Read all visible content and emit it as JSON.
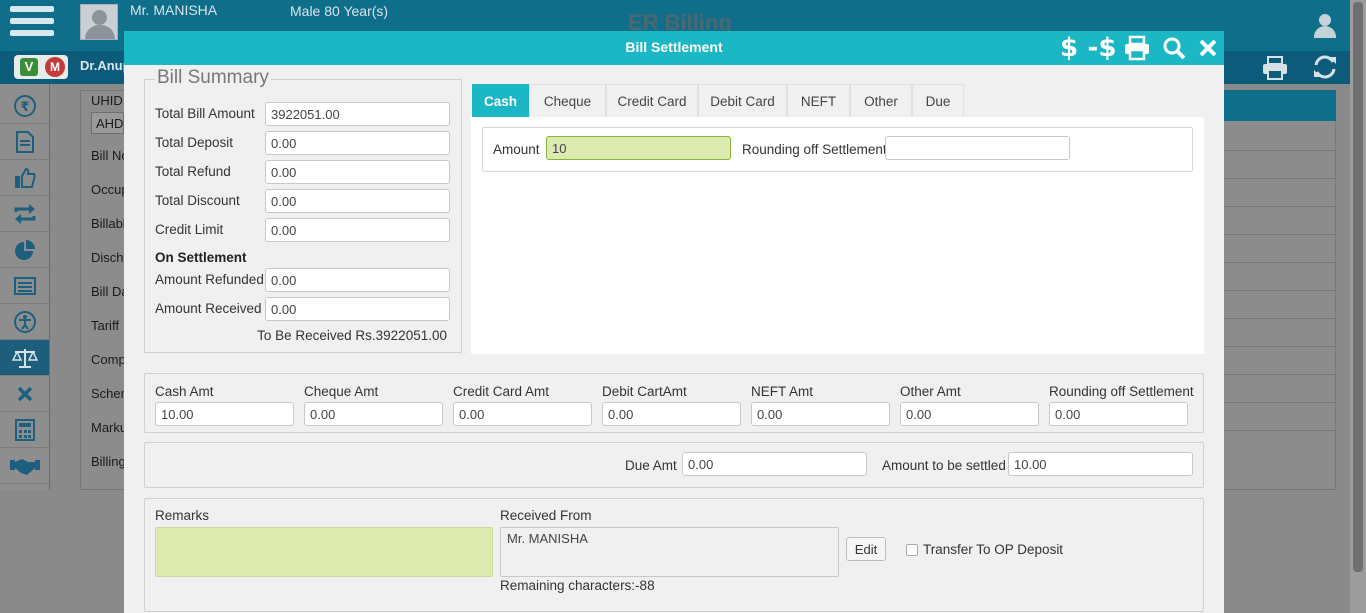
{
  "app": {
    "title": "ER Billing",
    "patient_name": "Mr. MANISHA",
    "patient_info": "Male 80 Year(s)",
    "doctor": "Dr.Anup",
    "badge_v": "V",
    "badge_m": "M"
  },
  "background_form": {
    "labels": [
      "UHID",
      "AHD",
      "Bill No",
      "Occup",
      "Billabl",
      "Discha",
      "Bill Da",
      "Tariff",
      "Comp",
      "Schem",
      "Marku",
      "Billing"
    ]
  },
  "side_nav": {
    "items": [
      "rupee-icon",
      "document-icon",
      "thumbs-up-icon",
      "exchange-icon",
      "pie-chart-icon",
      "list-icon",
      "accessibility-icon",
      "scale-icon",
      "close-icon",
      "calculator-icon",
      "handshake-icon"
    ],
    "active_index": 7
  },
  "modal": {
    "title": "Bill Settlement",
    "header_icons": [
      "dollar-icon",
      "minus-dollar-icon",
      "print-icon",
      "search-icon",
      "close-icon"
    ],
    "minus_dollar_text": "-$",
    "dollar_text": "$"
  },
  "bill_summary": {
    "legend": "Bill Summary",
    "total_bill_amount": {
      "label": "Total Bill Amount",
      "value": "3922051.00"
    },
    "total_deposit": {
      "label": "Total Deposit",
      "value": "0.00"
    },
    "total_refund": {
      "label": "Total Refund",
      "value": "0.00"
    },
    "total_discount": {
      "label": "Total Discount",
      "value": "0.00"
    },
    "credit_limit": {
      "label": "Credit Limit",
      "value": "0.00"
    },
    "on_settlement": "On Settlement",
    "amount_refunded": {
      "label": "Amount Refunded",
      "value": "0.00"
    },
    "amount_received": {
      "label": "Amount Received",
      "value": "0.00"
    },
    "to_be_received": "To Be Received Rs.3922051.00"
  },
  "tabs": {
    "items": [
      "Cash",
      "Cheque",
      "Credit Card",
      "Debit Card",
      "NEFT",
      "Other",
      "Due"
    ],
    "active": "Cash"
  },
  "cash_tab": {
    "amount_label": "Amount",
    "amount_value": "10",
    "rounding_label": "Rounding off Settlement",
    "rounding_value": ""
  },
  "amounts": {
    "cash": {
      "label": "Cash Amt",
      "value": "10.00"
    },
    "cheque": {
      "label": "Cheque Amt",
      "value": "0.00"
    },
    "credit_card": {
      "label": "Credit Card Amt",
      "value": "0.00"
    },
    "debit_card": {
      "label": "Debit CartAmt",
      "value": "0.00"
    },
    "neft": {
      "label": "NEFT Amt",
      "value": "0.00"
    },
    "other": {
      "label": "Other Amt",
      "value": "0.00"
    },
    "rounding": {
      "label": "Rounding off Settlement",
      "value": "0.00"
    }
  },
  "due": {
    "due_label": "Due Amt",
    "due_value": "0.00",
    "settle_label": "Amount to be settled",
    "settle_value": "10.00"
  },
  "remarks": {
    "remarks_label": "Remarks",
    "remarks_value": "",
    "received_from_label": "Received From",
    "received_from_value": "Mr. MANISHA",
    "remaining_chars": "Remaining characters:-88",
    "edit_label": "Edit",
    "transfer_label": "Transfer To OP Deposit",
    "transfer_checked": false
  },
  "colors": {
    "modal_header": "#1cb7c4",
    "active_tab": "#1cb7c4",
    "focused_input": "#dceab0",
    "app_header": "#0f6f8a"
  }
}
